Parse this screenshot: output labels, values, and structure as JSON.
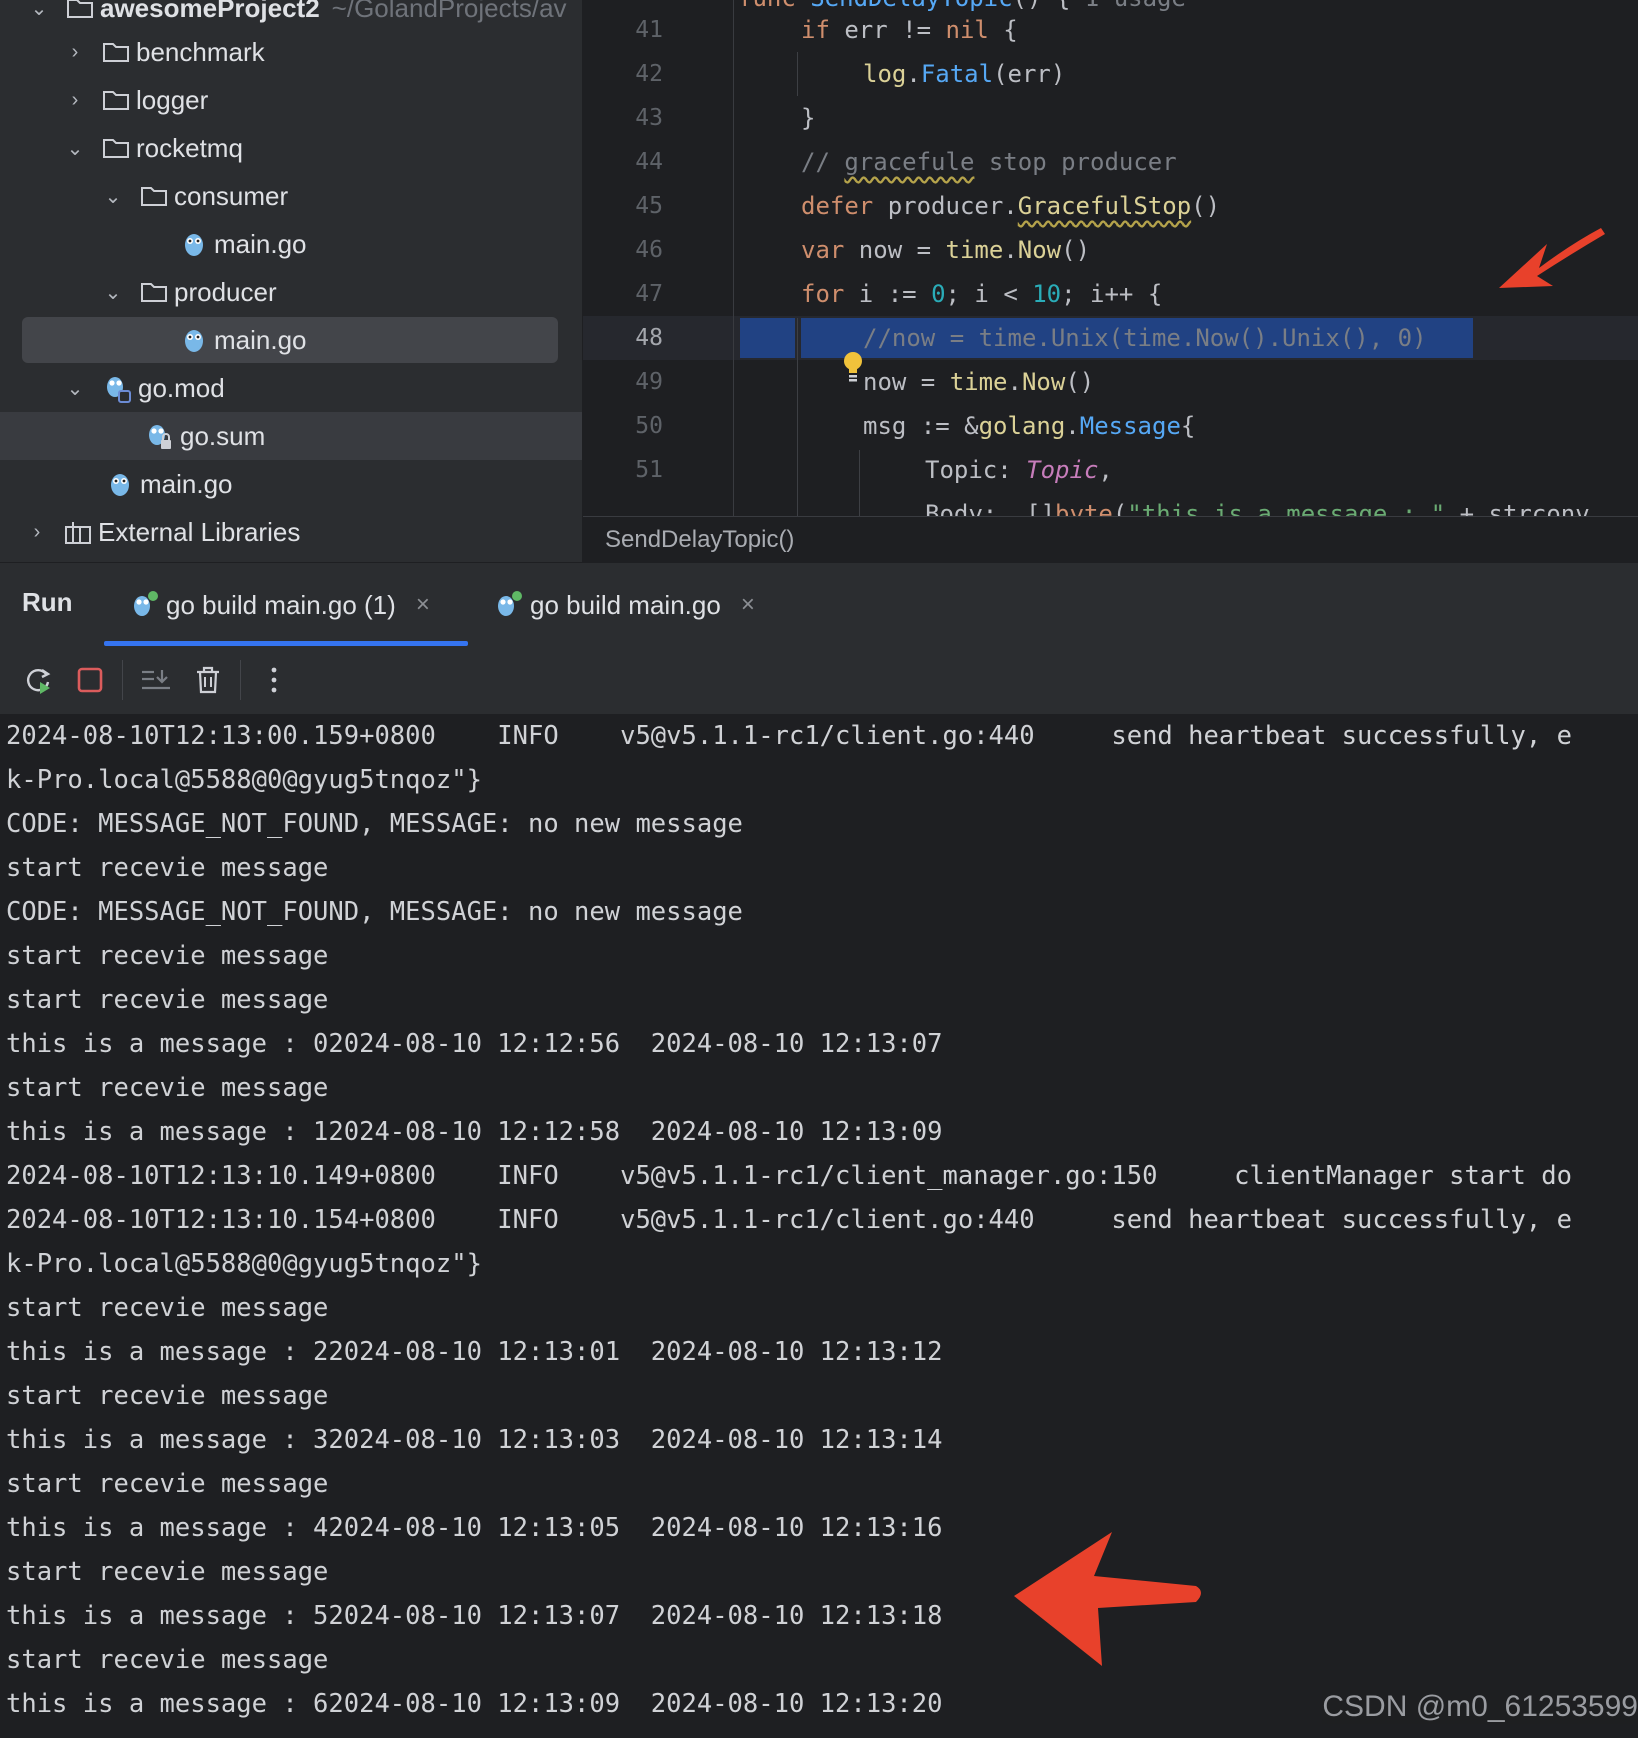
{
  "project_tree": {
    "root_label": "awesomeProject2",
    "root_path": "~/GolandProjects/av",
    "items": [
      {
        "label": "benchmark",
        "type": "folder",
        "expanded": false,
        "depth": 1
      },
      {
        "label": "logger",
        "type": "folder",
        "expanded": false,
        "depth": 1
      },
      {
        "label": "rocketmq",
        "type": "folder",
        "expanded": true,
        "depth": 1
      },
      {
        "label": "consumer",
        "type": "folder",
        "expanded": true,
        "depth": 2
      },
      {
        "label": "main.go",
        "type": "gofile",
        "depth": 3
      },
      {
        "label": "producer",
        "type": "folder",
        "expanded": true,
        "depth": 2
      },
      {
        "label": "main.go",
        "type": "gofile",
        "depth": 3,
        "selected": true
      },
      {
        "label": "go.mod",
        "type": "gomod",
        "expanded": true,
        "depth": 1
      },
      {
        "label": "go.sum",
        "type": "gosum",
        "depth": 2
      },
      {
        "label": "main.go",
        "type": "gofile",
        "depth": 1
      },
      {
        "label": "External Libraries",
        "type": "library",
        "expanded": false,
        "depth": 0
      }
    ]
  },
  "editor": {
    "current_line": "48",
    "lines": [
      {
        "n": "41",
        "indent": 0
      },
      {
        "n": "42",
        "indent": 0
      },
      {
        "n": "43",
        "indent": 0
      },
      {
        "n": "44",
        "indent": 0
      },
      {
        "n": "45",
        "indent": 0
      },
      {
        "n": "46",
        "indent": 0
      },
      {
        "n": "47",
        "indent": 0
      },
      {
        "n": "48",
        "indent": 0
      },
      {
        "n": "49",
        "indent": 0
      },
      {
        "n": "50",
        "indent": 0
      },
      {
        "n": "51",
        "indent": 0
      }
    ],
    "code": {
      "l41_a": "if",
      "l41_b": " err != ",
      "l41_c": "nil",
      "l41_d": " {",
      "l42_a": "log",
      "l42_b": ".",
      "l42_c": "Fatal",
      "l42_d": "(err)",
      "l43": "}",
      "l44_a": "// ",
      "l44_b": "gracefule",
      "l44_c": " stop producer",
      "l45_a": "defer",
      "l45_b": " producer.",
      "l45_c": "GracefulStop",
      "l45_d": "()",
      "l46_a": "var",
      "l46_b": " now = ",
      "l46_c": "time",
      "l46_d": ".",
      "l46_e": "Now",
      "l46_f": "()",
      "l47_a": "for",
      "l47_b": " i := ",
      "l47_c": "0",
      "l47_d": "; i < ",
      "l47_e": "10",
      "l47_f": "; i++ {",
      "l48": "//now = time.Unix(time.Now().Unix(), 0)",
      "l49_a": "now = ",
      "l49_b": "time",
      "l49_c": ".",
      "l49_d": "Now",
      "l49_e": "()",
      "l50_a": "msg := &",
      "l50_b": "golang",
      "l50_c": ".",
      "l50_d": "Message",
      "l50_e": "{",
      "l51_a": "Topic: ",
      "l51_b": "Topic",
      "l51_c": ",",
      "l52_a": "Body:  []",
      "l52_b": "byte",
      "l52_c": "(",
      "l52_d": "\"this is a message : \"",
      "l52_e": " + strconv"
    },
    "breadcrumb": "SendDelayTopic()"
  },
  "run_panel": {
    "title": "Run",
    "tabs": [
      {
        "label": "go build main.go (1)",
        "active": true
      },
      {
        "label": "go build main.go",
        "active": false
      }
    ],
    "close_glyph": "×"
  },
  "console": {
    "lines": [
      "2024-08-10T12:13:00.159+0800    INFO    v5@v5.1.1-rc1/client.go:440     send heartbeat successfully, e",
      "k-Pro.local@5588@0@gyug5tnqoz\"}",
      "CODE: MESSAGE_NOT_FOUND, MESSAGE: no new message",
      "start recevie message",
      "CODE: MESSAGE_NOT_FOUND, MESSAGE: no new message",
      "start recevie message",
      "start recevie message",
      "this is a message : 02024-08-10 12:12:56  2024-08-10 12:13:07",
      "start recevie message",
      "this is a message : 12024-08-10 12:12:58  2024-08-10 12:13:09",
      "2024-08-10T12:13:10.149+0800    INFO    v5@v5.1.1-rc1/client_manager.go:150     clientManager start do",
      "2024-08-10T12:13:10.154+0800    INFO    v5@v5.1.1-rc1/client.go:440     send heartbeat successfully, e",
      "k-Pro.local@5588@0@gyug5tnqoz\"}",
      "start recevie message",
      "this is a message : 22024-08-10 12:13:01  2024-08-10 12:13:12",
      "start recevie message",
      "this is a message : 32024-08-10 12:13:03  2024-08-10 12:13:14",
      "start recevie message",
      "this is a message : 42024-08-10 12:13:05  2024-08-10 12:13:16",
      "start recevie message",
      "this is a message : 52024-08-10 12:13:07  2024-08-10 12:13:18",
      "start recevie message",
      "this is a message : 62024-08-10 12:13:09  2024-08-10 12:13:20"
    ]
  },
  "watermark": "CSDN @m0_61253599",
  "colors": {
    "accent": "#3574f0",
    "selection": "#214283",
    "annotation_arrow": "#e8412b",
    "stop_button": "#db5c5c",
    "rerun_button": "#5fb865"
  }
}
